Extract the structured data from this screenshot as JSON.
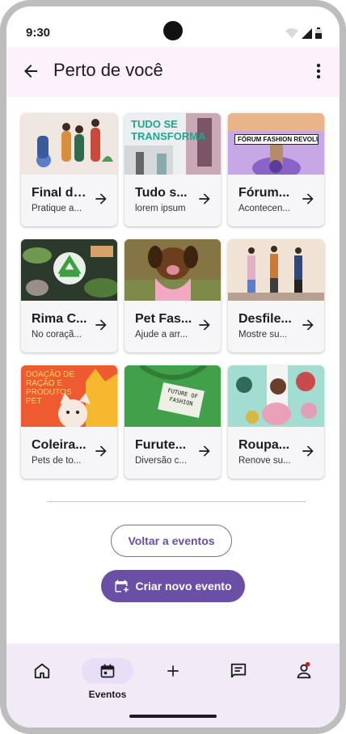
{
  "status_bar": {
    "time": "9:30"
  },
  "app_bar": {
    "title": "Perto de você"
  },
  "cards": [
    {
      "title": "Final de...",
      "subtitle": "Pratique a..."
    },
    {
      "title": "Tudo s...",
      "subtitle": "lorem ipsum",
      "image_text": "TUDO SE TRANSFORMA"
    },
    {
      "title": "Fórum...",
      "subtitle": "Acontecen...",
      "image_text": "FÓRUM FASHION REVOLUTION"
    },
    {
      "title": "Rima C...",
      "subtitle": "No coraçã..."
    },
    {
      "title": "Pet Fas...",
      "subtitle": "Ajude a arr..."
    },
    {
      "title": "Desfile...",
      "subtitle": "Mostre su..."
    },
    {
      "title": "Coleira...",
      "subtitle": "Pets de to...",
      "image_text": "DOAÇÃO DE RAÇÃO E PRODUTOS PET"
    },
    {
      "title": "Furute...",
      "subtitle": "Diversão c...",
      "image_text": "FUTURE OF FASHION"
    },
    {
      "title": "Roupa...",
      "subtitle": "Renove su..."
    }
  ],
  "buttons": {
    "back_to_events": "Voltar a eventos",
    "create_event": "Criar novo evento"
  },
  "nav": {
    "active_label": "Eventos",
    "items": [
      "home-icon",
      "calendar-icon",
      "add-icon",
      "chat-icon",
      "profile-icon"
    ]
  },
  "colors": {
    "primary": "#6a4fa7",
    "app_bar_bg": "#fbf2fb",
    "nav_bg": "#f2ebf6",
    "active_pill": "#e8def8"
  }
}
